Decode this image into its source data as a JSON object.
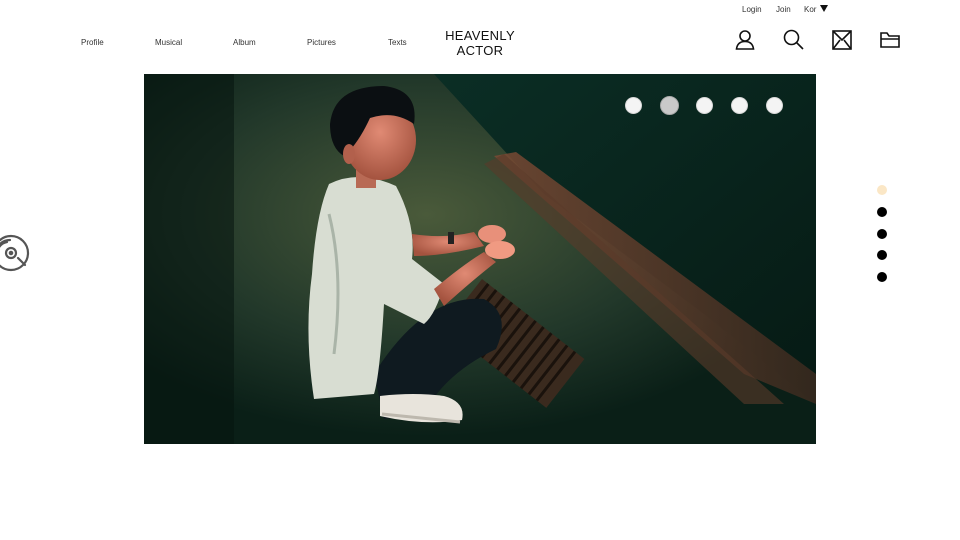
{
  "utility": {
    "login": "Login",
    "join": "Join",
    "language": "Kor"
  },
  "nav": [
    "Profile",
    "Musical",
    "Album",
    "Pictures",
    "Texts"
  ],
  "logo": {
    "line1": "HEAVENLY",
    "line2": "ACTOR"
  },
  "header_icons": [
    "user-icon",
    "search-icon",
    "mail-icon",
    "folder-icon"
  ],
  "hero": {
    "image": "night-street-portrait",
    "slide_count": 5,
    "active_slide": 2
  },
  "side_nav": {
    "count": 5,
    "active": 1,
    "active_color": "#fbe7c6",
    "color": "#000000"
  },
  "floating_icon": "music-disc-icon"
}
